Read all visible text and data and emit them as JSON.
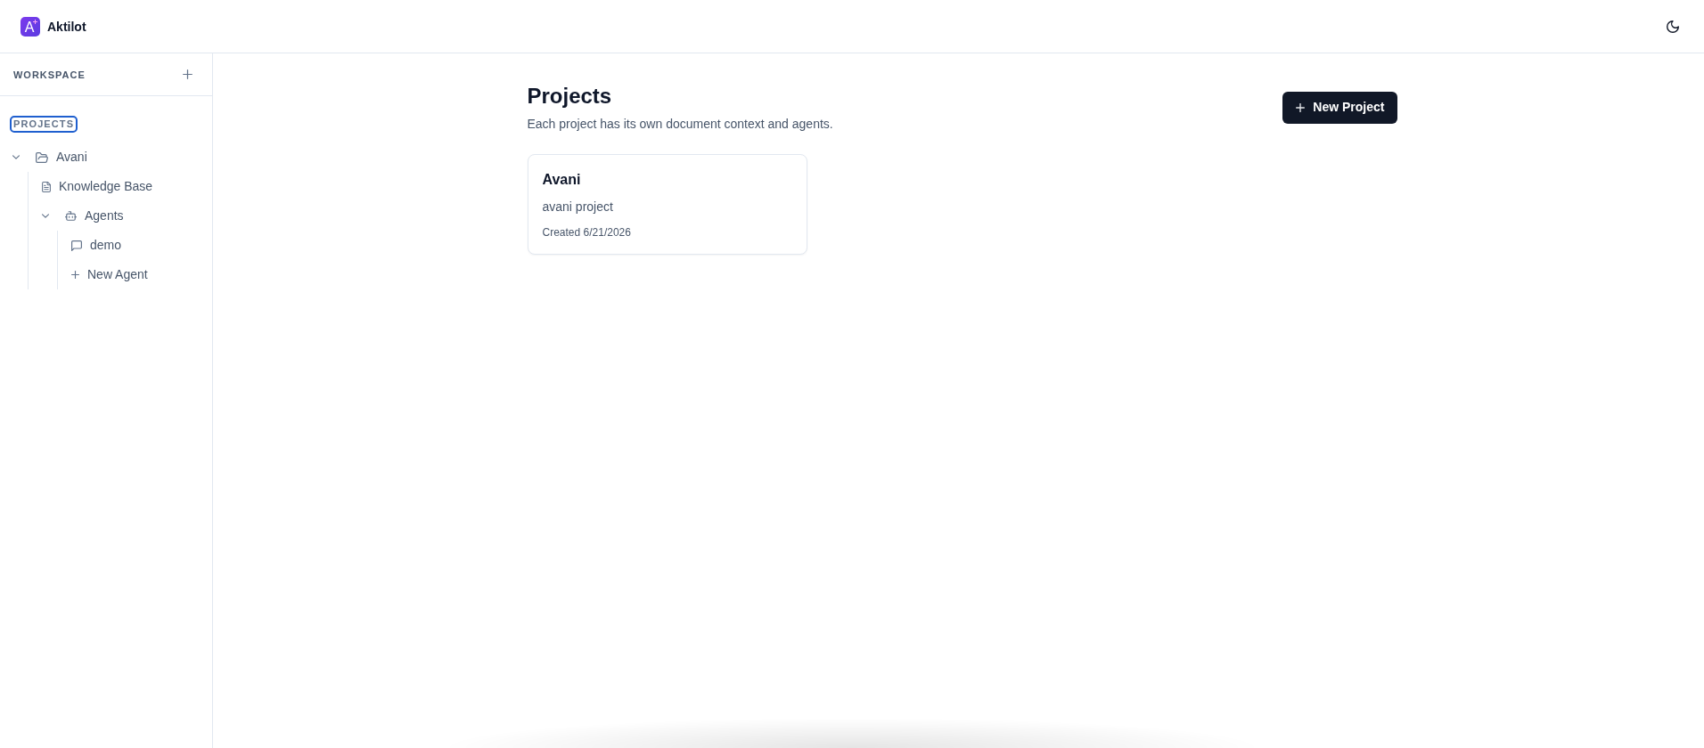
{
  "app": {
    "logo_letter": "A",
    "name": "Aktilot"
  },
  "sidebar": {
    "title": "WORKSPACE",
    "section": {
      "label": "PROJECTS",
      "focused": true
    },
    "tree": [
      {
        "kind": "project",
        "label": "Avani",
        "expanded": true,
        "children": [
          {
            "kind": "document",
            "label": "Knowledge Base"
          },
          {
            "kind": "agents",
            "label": "Agents",
            "expanded": true,
            "children": [
              {
                "kind": "chat",
                "label": "demo"
              },
              {
                "kind": "add",
                "label": "New Agent"
              }
            ]
          }
        ]
      }
    ]
  },
  "page": {
    "title": "Projects",
    "subtitle": "Each project has its own document context and agents.",
    "new_button": "New Project",
    "projects": [
      {
        "name": "Avani",
        "description": "avani project",
        "created": "Created 6/21/2026"
      }
    ]
  }
}
